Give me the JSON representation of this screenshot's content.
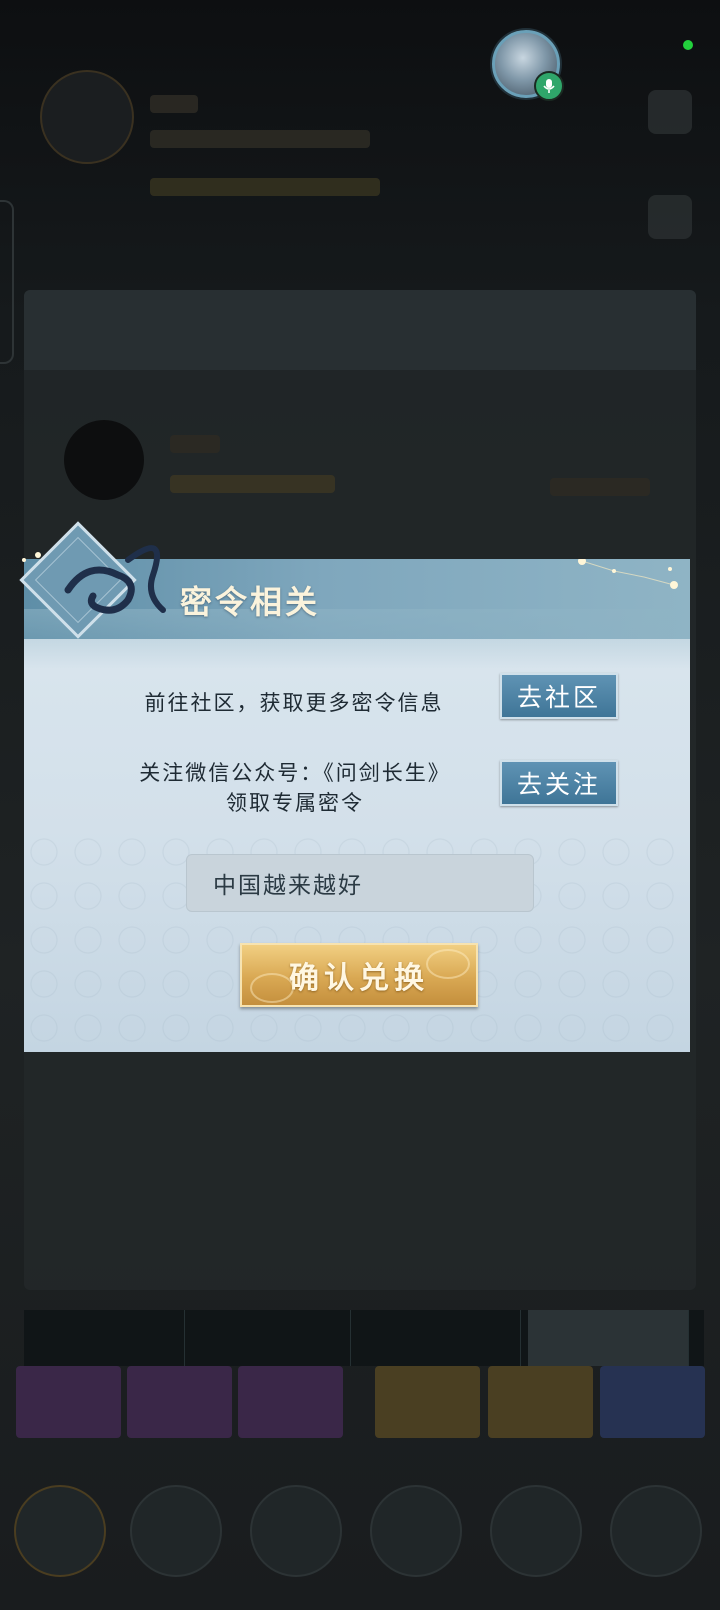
{
  "dialog": {
    "title": "密令相关",
    "community_text": "前往社区，获取更多密令信息",
    "community_button": "去社区",
    "wechat_text_line1": "关注微信公众号：《问剑长生》",
    "wechat_text_line2": "领取专属密令",
    "follow_button": "去关注",
    "code_value": "中国越来越好",
    "confirm_button": "确认兑换"
  },
  "colors": {
    "header_blue": "#5e8ea7",
    "button_blue": "#3f7597",
    "confirm_gold": "#d9a853",
    "status_green": "#22d13c",
    "mic_green": "#2fa66a"
  },
  "icons": {
    "voice_avatar": "player-avatar",
    "mic": "microphone-icon",
    "status": "online-status-dot",
    "emblem": "dragon-emblem-icon"
  }
}
